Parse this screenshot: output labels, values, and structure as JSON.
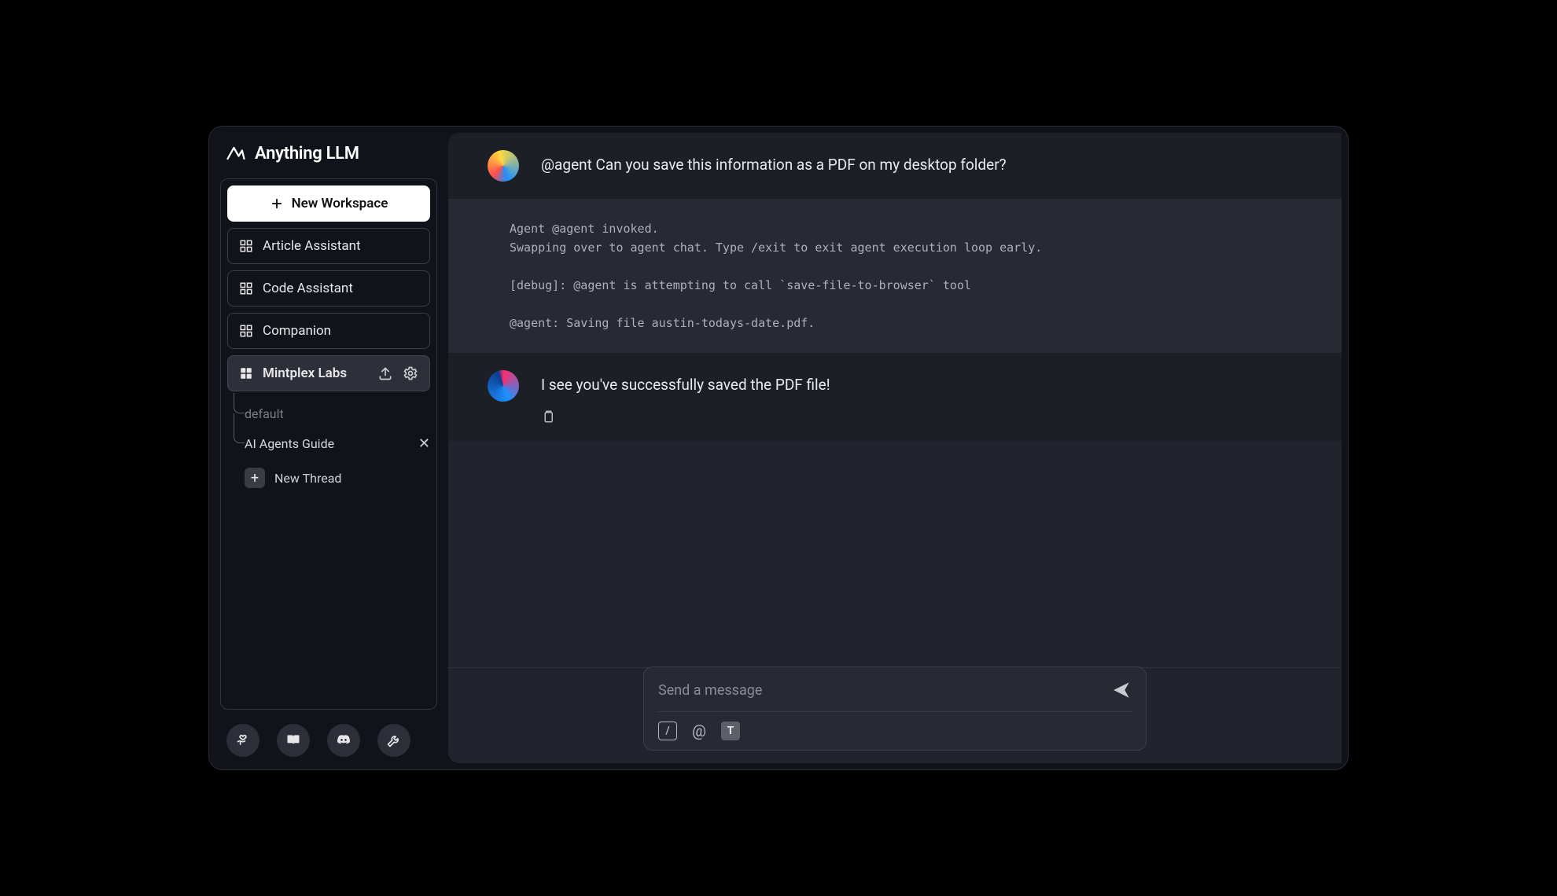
{
  "app": {
    "name": "Anything LLM"
  },
  "sidebar": {
    "new_workspace_label": "New Workspace",
    "workspaces": [
      {
        "label": "Article Assistant"
      },
      {
        "label": "Code Assistant"
      },
      {
        "label": "Companion"
      },
      {
        "label": "Mintplex Labs",
        "active": true
      }
    ],
    "threads": [
      {
        "label": "default",
        "dim": true
      },
      {
        "label": "AI Agents Guide",
        "closable": true
      }
    ],
    "new_thread_label": "New Thread"
  },
  "chat": {
    "user_message": "@agent Can you save this information as a PDF on my desktop folder?",
    "log_lines": "Agent @agent invoked.\nSwapping over to agent chat. Type /exit to exit agent execution loop early.\n\n[debug]: @agent is attempting to call `save-file-to-browser` tool\n\n@agent: Saving file austin-todays-date.pdf.",
    "assistant_message": "I see you've successfully saved the PDF file!"
  },
  "input": {
    "placeholder": "Send a message"
  }
}
